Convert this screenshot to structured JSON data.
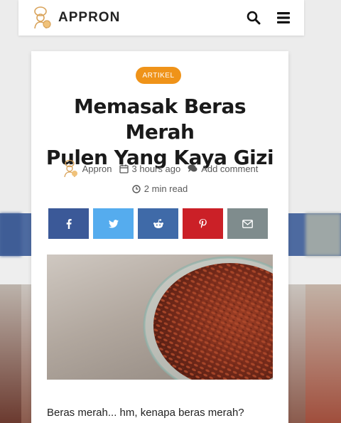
{
  "header": {
    "brand": "APPRON",
    "icons": [
      "search-icon",
      "menu-icon"
    ]
  },
  "article": {
    "category": "ARTIKEL",
    "title_line1": "Memasak Beras Merah",
    "title_line2": "Pulen Yang Kaya Gizi",
    "author": "Appron",
    "time_ago": "3 hours ago",
    "comment_label": "Add comment",
    "read_time": "2 min read",
    "intro": "Beras merah... hm, kenapa beras merah?"
  },
  "share_buttons": [
    {
      "network": "facebook",
      "icon": "facebook-icon",
      "color": "#3b5998"
    },
    {
      "network": "twitter",
      "icon": "twitter-icon",
      "color": "#55acee"
    },
    {
      "network": "reddit",
      "icon": "reddit-icon",
      "color": "#3f6aa8"
    },
    {
      "network": "pinterest",
      "icon": "pinterest-icon",
      "color": "#cb2027"
    },
    {
      "network": "email",
      "icon": "email-icon",
      "color": "#7f8c8d"
    }
  ],
  "colors": {
    "accent": "#ef9319"
  }
}
